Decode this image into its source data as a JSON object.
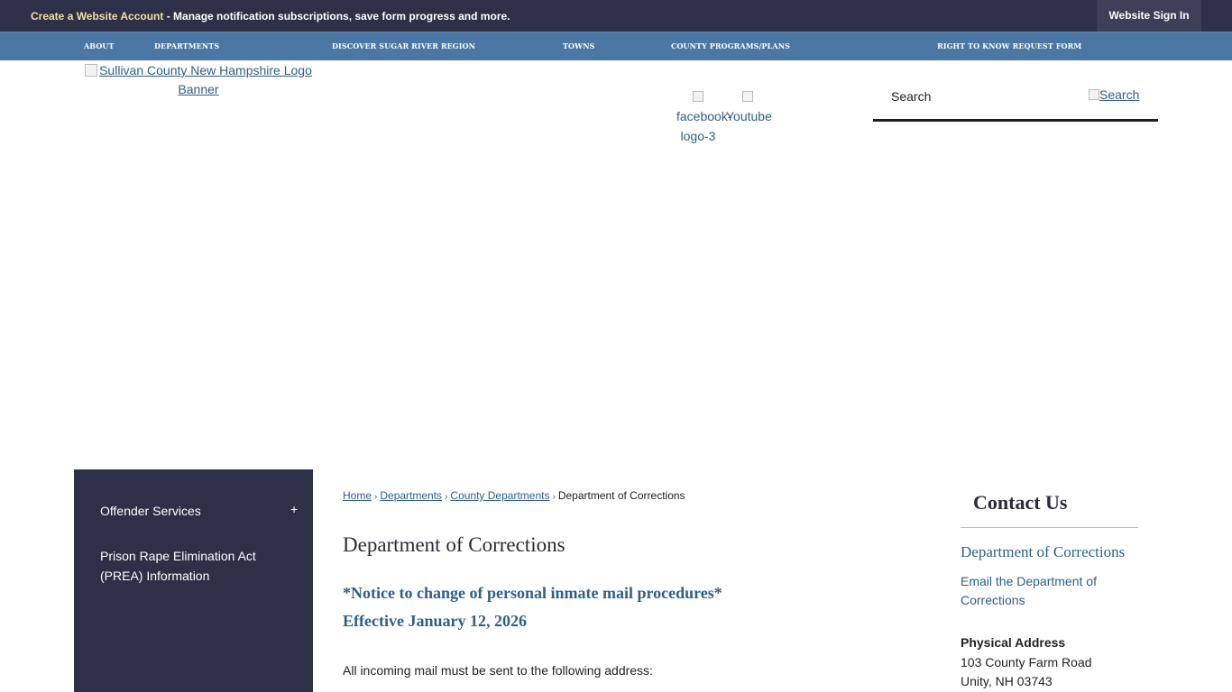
{
  "topbar": {
    "promo_link": "Create a Website Account",
    "promo_text": " - Manage notification subscriptions, save form progress and more.",
    "signin_label": "Website Sign In"
  },
  "nav": {
    "items": [
      "ABOUT",
      "DEPARTMENTS",
      "DISCOVER SUGAR RIVER REGION",
      "TOWNS",
      "COUNTY PROGRAMS/PLANS",
      "RIGHT TO KNOW REQUEST FORM"
    ]
  },
  "header": {
    "logo_alt": "Sullivan County New Hampshire Logo Banner",
    "facebook_alt": "facebook-logo-3",
    "youtube_alt": "Youtube"
  },
  "search": {
    "placeholder": "Search",
    "button_alt": "Search"
  },
  "sidebar": {
    "items": [
      {
        "label": "Offender Services",
        "toggle": "+"
      },
      {
        "label": "Prison Rape Elimination Act (PREA) Information"
      }
    ]
  },
  "breadcrumb": {
    "items": [
      "Home",
      "Departments",
      "County Departments"
    ],
    "current": "Department of Corrections"
  },
  "main": {
    "title": "Department of Corrections",
    "notice_line1": "*Notice to change of  personal inmate mail procedures*",
    "notice_line2": "Effective January 12, 2026",
    "body_line1": "All incoming mail must be sent to the following address:"
  },
  "contact": {
    "title": "Contact Us",
    "department": "Department of Corrections",
    "email_link": "Email the Department of Corrections",
    "address_label": "Physical Address",
    "address_line1": "103 County Farm Road",
    "address_line2": "Unity, NH 03743"
  },
  "colors": {
    "topbar_bg": "#2d3047",
    "nav_bg": "#4a77a4",
    "link": "#2f5f88",
    "accent_rule": "#e0b56a",
    "promo_highlight": "#f2dfa6"
  }
}
